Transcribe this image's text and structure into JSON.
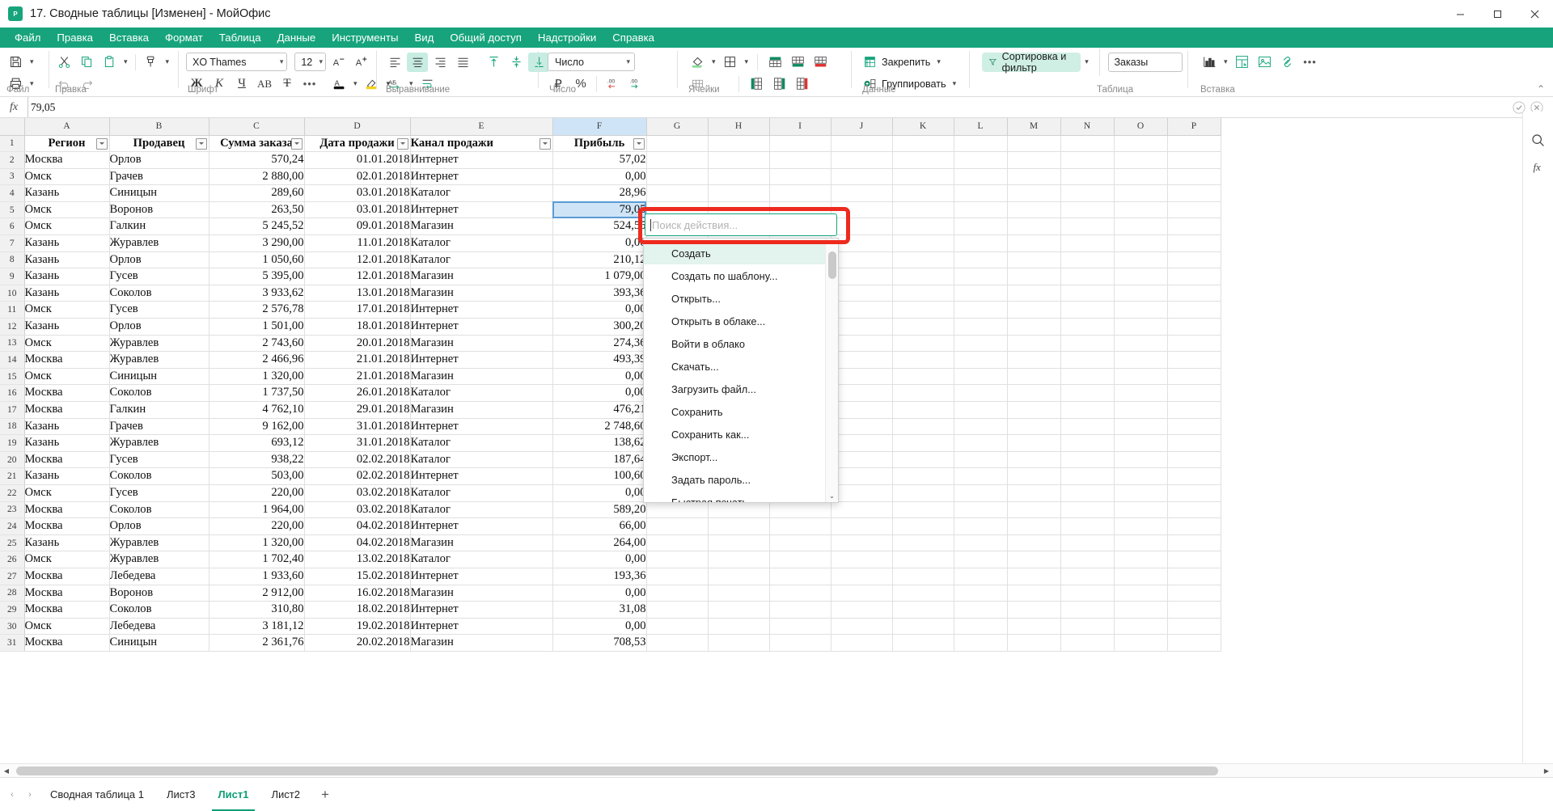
{
  "window": {
    "title": "17. Сводные таблицы [Изменен] - МойОфис",
    "logo_letter": "Р",
    "minimize": "—",
    "maximize": "▢",
    "close": "✕"
  },
  "menubar": {
    "items": [
      "Файл",
      "Правка",
      "Вставка",
      "Формат",
      "Таблица",
      "Данные",
      "Инструменты",
      "Вид",
      "Общий доступ",
      "Надстройки",
      "Справка"
    ]
  },
  "ribbon": {
    "groups": [
      {
        "label": "Файл"
      },
      {
        "label": "Правка"
      },
      {
        "label": "Шрифт"
      },
      {
        "label": "Выравнивание"
      },
      {
        "label": "Число"
      },
      {
        "label": "Ячейки"
      },
      {
        "label": "Данные"
      },
      {
        "label": "Таблица"
      },
      {
        "label": "Вставка"
      }
    ],
    "font_name": "XO Thames",
    "font_size": "12",
    "number_format": "Число",
    "freeze_label": "Закрепить",
    "group_label": "Группировать",
    "sort_filter_label": "Сортировка и фильтр",
    "table_name": "Заказы",
    "collapse_ribbon": "⌃"
  },
  "formula_bar": {
    "fx": "fx",
    "value": "79,05",
    "accept": "✓",
    "cancel": "✕"
  },
  "grid": {
    "columns": [
      "A",
      "B",
      "C",
      "D",
      "E",
      "F",
      "G",
      "H",
      "I",
      "J",
      "K",
      "L",
      "M",
      "N",
      "O",
      "P"
    ],
    "selected_column": "F",
    "selected_cell": "F5",
    "header_row": {
      "index": "1",
      "cells": [
        "Регион",
        "Продавец",
        "Сумма заказа",
        "Дата продажи",
        "Канал продажи",
        "Прибыль"
      ]
    },
    "rows": [
      {
        "n": "2",
        "region": "Москва",
        "seller": "Орлов",
        "amount": "570,24",
        "date": "01.01.2018",
        "channel": "Интернет",
        "profit": "57,02"
      },
      {
        "n": "3",
        "region": "Омск",
        "seller": "Грачев",
        "amount": "2 880,00",
        "date": "02.01.2018",
        "channel": "Интернет",
        "profit": "0,00"
      },
      {
        "n": "4",
        "region": "Казань",
        "seller": "Синицын",
        "amount": "289,60",
        "date": "03.01.2018",
        "channel": "Каталог",
        "profit": "28,96"
      },
      {
        "n": "5",
        "region": "Омск",
        "seller": "Воронов",
        "amount": "263,50",
        "date": "03.01.2018",
        "channel": "Интернет",
        "profit": "79,05"
      },
      {
        "n": "6",
        "region": "Омск",
        "seller": "Галкин",
        "amount": "5 245,52",
        "date": "09.01.2018",
        "channel": "Магазин",
        "profit": "524,55"
      },
      {
        "n": "7",
        "region": "Казань",
        "seller": "Журавлев",
        "amount": "3 290,00",
        "date": "11.01.2018",
        "channel": "Каталог",
        "profit": "0,00"
      },
      {
        "n": "8",
        "region": "Казань",
        "seller": "Орлов",
        "amount": "1 050,60",
        "date": "12.01.2018",
        "channel": "Каталог",
        "profit": "210,12"
      },
      {
        "n": "9",
        "region": "Казань",
        "seller": "Гусев",
        "amount": "5 395,00",
        "date": "12.01.2018",
        "channel": "Магазин",
        "profit": "1 079,00"
      },
      {
        "n": "10",
        "region": "Казань",
        "seller": "Соколов",
        "amount": "3 933,62",
        "date": "13.01.2018",
        "channel": "Магазин",
        "profit": "393,36"
      },
      {
        "n": "11",
        "region": "Омск",
        "seller": "Гусев",
        "amount": "2 576,78",
        "date": "17.01.2018",
        "channel": "Интернет",
        "profit": "0,00"
      },
      {
        "n": "12",
        "region": "Казань",
        "seller": "Орлов",
        "amount": "1 501,00",
        "date": "18.01.2018",
        "channel": "Интернет",
        "profit": "300,20"
      },
      {
        "n": "13",
        "region": "Омск",
        "seller": "Журавлев",
        "amount": "2 743,60",
        "date": "20.01.2018",
        "channel": "Магазин",
        "profit": "274,36"
      },
      {
        "n": "14",
        "region": "Москва",
        "seller": "Журавлев",
        "amount": "2 466,96",
        "date": "21.01.2018",
        "channel": "Интернет",
        "profit": "493,39"
      },
      {
        "n": "15",
        "region": "Омск",
        "seller": "Синицын",
        "amount": "1 320,00",
        "date": "21.01.2018",
        "channel": "Магазин",
        "profit": "0,00"
      },
      {
        "n": "16",
        "region": "Москва",
        "seller": "Соколов",
        "amount": "1 737,50",
        "date": "26.01.2018",
        "channel": "Каталог",
        "profit": "0,00"
      },
      {
        "n": "17",
        "region": "Москва",
        "seller": "Галкин",
        "amount": "4 762,10",
        "date": "29.01.2018",
        "channel": "Магазин",
        "profit": "476,21"
      },
      {
        "n": "18",
        "region": "Казань",
        "seller": "Грачев",
        "amount": "9 162,00",
        "date": "31.01.2018",
        "channel": "Интернет",
        "profit": "2 748,60"
      },
      {
        "n": "19",
        "region": "Казань",
        "seller": "Журавлев",
        "amount": "693,12",
        "date": "31.01.2018",
        "channel": "Каталог",
        "profit": "138,62"
      },
      {
        "n": "20",
        "region": "Москва",
        "seller": "Гусев",
        "amount": "938,22",
        "date": "02.02.2018",
        "channel": "Каталог",
        "profit": "187,64"
      },
      {
        "n": "21",
        "region": "Казань",
        "seller": "Соколов",
        "amount": "503,00",
        "date": "02.02.2018",
        "channel": "Интернет",
        "profit": "100,60"
      },
      {
        "n": "22",
        "region": "Омск",
        "seller": "Гусев",
        "amount": "220,00",
        "date": "03.02.2018",
        "channel": "Каталог",
        "profit": "0,00"
      },
      {
        "n": "23",
        "region": "Москва",
        "seller": "Соколов",
        "amount": "1 964,00",
        "date": "03.02.2018",
        "channel": "Каталог",
        "profit": "589,20"
      },
      {
        "n": "24",
        "region": "Москва",
        "seller": "Орлов",
        "amount": "220,00",
        "date": "04.02.2018",
        "channel": "Интернет",
        "profit": "66,00"
      },
      {
        "n": "25",
        "region": "Казань",
        "seller": "Журавлев",
        "amount": "1 320,00",
        "date": "04.02.2018",
        "channel": "Магазин",
        "profit": "264,00"
      },
      {
        "n": "26",
        "region": "Омск",
        "seller": "Журавлев",
        "amount": "1 702,40",
        "date": "13.02.2018",
        "channel": "Каталог",
        "profit": "0,00"
      },
      {
        "n": "27",
        "region": "Москва",
        "seller": "Лебедева",
        "amount": "1 933,60",
        "date": "15.02.2018",
        "channel": "Интернет",
        "profit": "193,36"
      },
      {
        "n": "28",
        "region": "Москва",
        "seller": "Воронов",
        "amount": "2 912,00",
        "date": "16.02.2018",
        "channel": "Магазин",
        "profit": "0,00"
      },
      {
        "n": "29",
        "region": "Москва",
        "seller": "Соколов",
        "amount": "310,80",
        "date": "18.02.2018",
        "channel": "Интернет",
        "profit": "31,08"
      },
      {
        "n": "30",
        "region": "Омск",
        "seller": "Лебедева",
        "amount": "3 181,12",
        "date": "19.02.2018",
        "channel": "Интернет",
        "profit": "0,00"
      },
      {
        "n": "31",
        "region": "Москва",
        "seller": "Синицын",
        "amount": "2 361,76",
        "date": "20.02.2018",
        "channel": "Магазин",
        "profit": "708,53"
      }
    ]
  },
  "command_palette": {
    "placeholder": "Поиск действия...",
    "value": "",
    "items": [
      {
        "label": "Создать",
        "selected": true
      },
      {
        "label": "Создать по шаблону...",
        "selected": false
      },
      {
        "label": "Открыть...",
        "selected": false
      },
      {
        "label": "Открыть в облаке...",
        "selected": false
      },
      {
        "label": "Войти в облако",
        "selected": false
      },
      {
        "label": "Скачать...",
        "selected": false
      },
      {
        "label": "Загрузить файл...",
        "selected": false
      },
      {
        "label": "Сохранить",
        "selected": false
      },
      {
        "label": "Сохранить как...",
        "selected": false
      },
      {
        "label": "Экспорт...",
        "selected": false
      },
      {
        "label": "Задать пароль...",
        "selected": false
      },
      {
        "label": "Быстрая печать",
        "selected": false
      }
    ],
    "scroll_up": "⌃",
    "scroll_down": "⌄"
  },
  "sheet_tabs": {
    "prev": "‹",
    "next": "›",
    "tabs": [
      {
        "label": "Сводная таблица 1",
        "active": false
      },
      {
        "label": "Лист3",
        "active": false
      },
      {
        "label": "Лист1",
        "active": true
      },
      {
        "label": "Лист2",
        "active": false
      }
    ],
    "add": "+"
  },
  "right_panel": {
    "icons": [
      "search-icon",
      "function-icon"
    ]
  },
  "colors": {
    "brand_green": "#17a47c",
    "accent_light": "#cfeee4",
    "selection_blue": "#cfe5f7",
    "highlight_red": "#ee2a1e"
  }
}
